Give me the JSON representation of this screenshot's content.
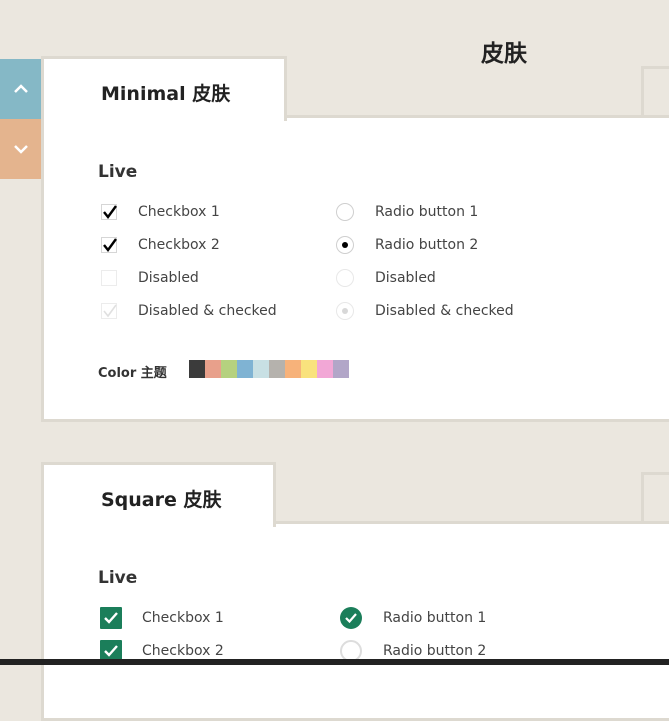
{
  "page": {
    "title": "皮肤"
  },
  "nav": {
    "up_icon": "chevron-up-icon",
    "down_icon": "chevron-down-icon",
    "up_color": "#85b8c6",
    "down_color": "#e4b48e"
  },
  "minimal": {
    "tab_label": "Minimal 皮肤",
    "section_label": "Live",
    "checkboxes": [
      {
        "label": "Checkbox 1",
        "checked": true,
        "disabled": false
      },
      {
        "label": "Checkbox 2",
        "checked": true,
        "disabled": false
      },
      {
        "label": "Disabled",
        "checked": false,
        "disabled": true
      },
      {
        "label": "Disabled & checked",
        "checked": true,
        "disabled": true
      }
    ],
    "radios": [
      {
        "label": "Radio button 1",
        "checked": false,
        "disabled": false
      },
      {
        "label": "Radio button 2",
        "checked": true,
        "disabled": false
      },
      {
        "label": "Disabled",
        "checked": false,
        "disabled": true
      },
      {
        "label": "Disabled & checked",
        "checked": true,
        "disabled": true
      }
    ],
    "color_label": "Color 主题",
    "colors": [
      "#3b3b3b",
      "#e8a08b",
      "#b5d17f",
      "#7fb3d3",
      "#c8e0e4",
      "#b5b2ad",
      "#f7b27a",
      "#f9e27d",
      "#f2a7d6",
      "#b2a6c8"
    ]
  },
  "square": {
    "tab_label": "Square 皮肤",
    "section_label": "Live",
    "checkboxes": [
      {
        "label": "Checkbox 1",
        "checked": true
      },
      {
        "label": "Checkbox 2",
        "checked": true
      }
    ],
    "radios": [
      {
        "label": "Radio button 1",
        "checked": true
      },
      {
        "label": "Radio button 2",
        "checked": false
      }
    ],
    "accent": "#1b7e5a"
  }
}
